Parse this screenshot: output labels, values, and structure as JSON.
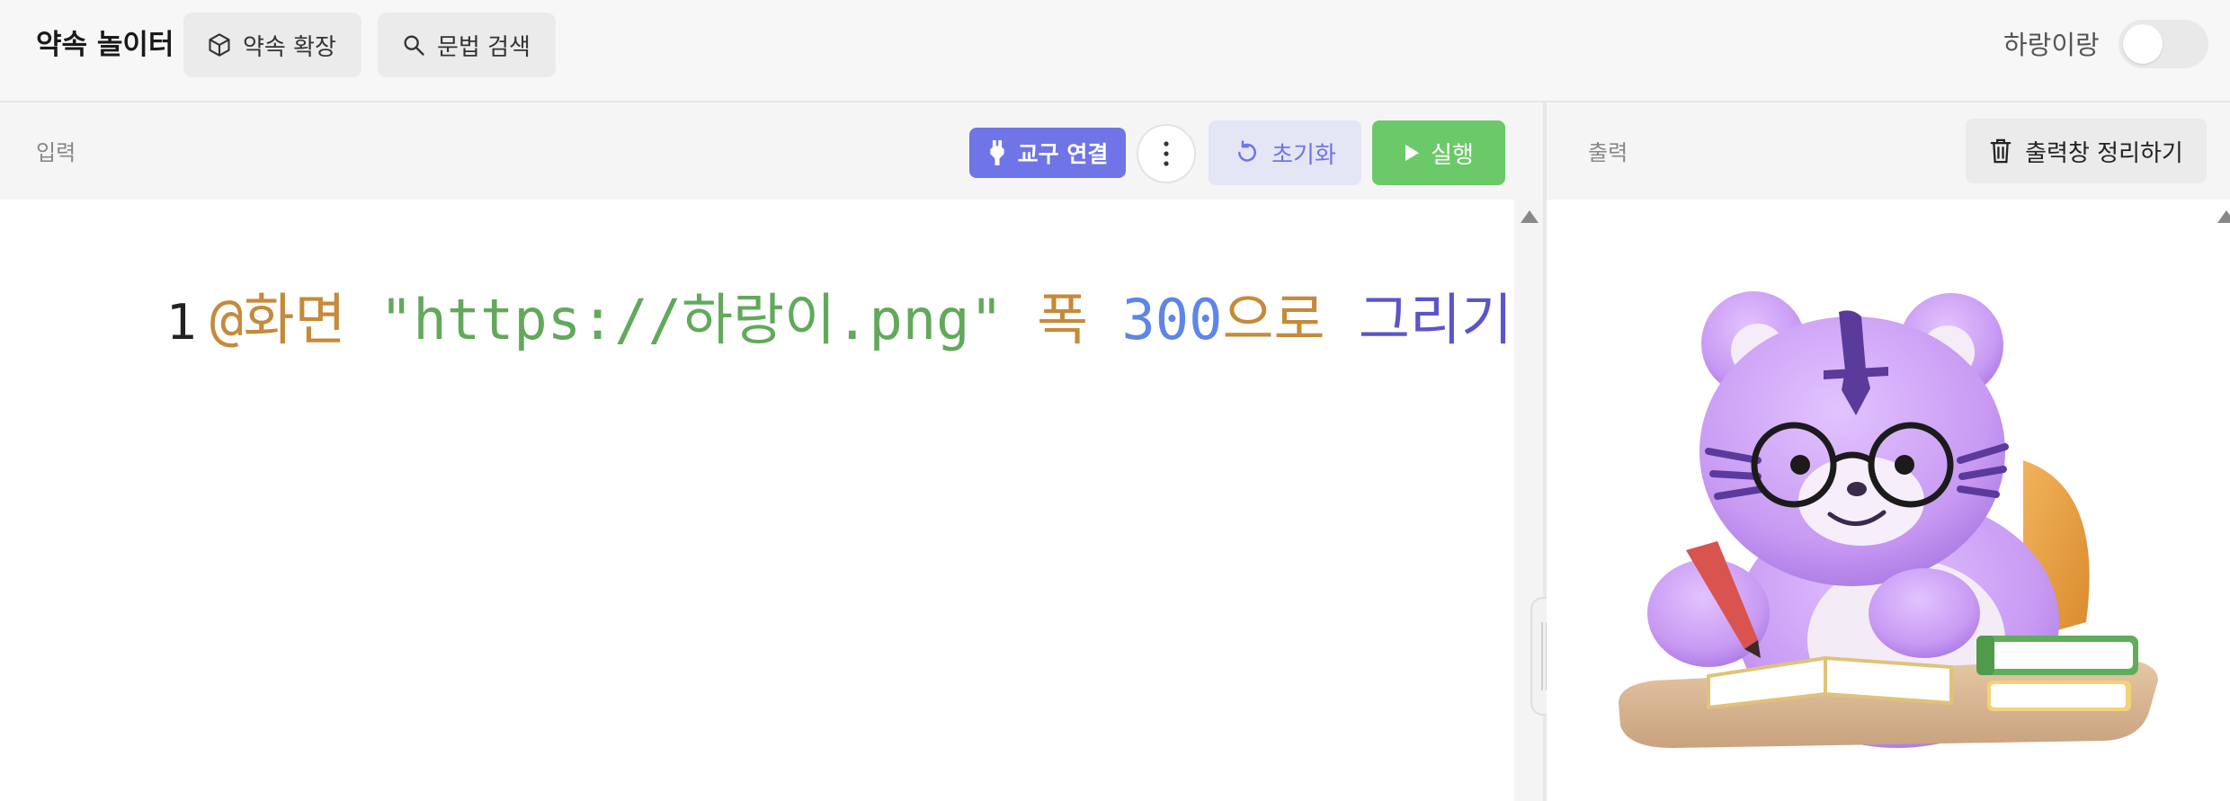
{
  "header": {
    "app_title": "약속 놀이터",
    "extend_label": "약속 확장",
    "search_label": "문법 검색",
    "theme_label": "하랑이랑",
    "theme_toggle_on": false
  },
  "input_panel": {
    "label": "입력",
    "connect_label": "교구 연결",
    "reset_label": "초기화",
    "run_label": "실행"
  },
  "editor": {
    "lines": [
      {
        "number": "1",
        "tokens": [
          {
            "text": "@화면",
            "color": "#c58a3a"
          },
          {
            "text": " ",
            "color": "#222222"
          },
          {
            "text": "\"https://하랑이.png\"",
            "color": "#62a95b"
          },
          {
            "text": " ",
            "color": "#222222"
          },
          {
            "text": "폭",
            "color": "#c58a3a"
          },
          {
            "text": " ",
            "color": "#222222"
          },
          {
            "text": "300",
            "color": "#5e86e6"
          },
          {
            "text": "으로",
            "color": "#c58a3a"
          },
          {
            "text": " ",
            "color": "#222222"
          },
          {
            "text": "그리기",
            "color": "#5b55cc"
          }
        ]
      }
    ]
  },
  "output_panel": {
    "label": "출력",
    "clear_label": "출력창 정리하기",
    "image_subject": "purple tiger character with glasses writing at a desk"
  },
  "colors": {
    "accent": "#6f74e6",
    "run_green": "#6cc96a",
    "reset_bg": "#e4e6f6"
  }
}
